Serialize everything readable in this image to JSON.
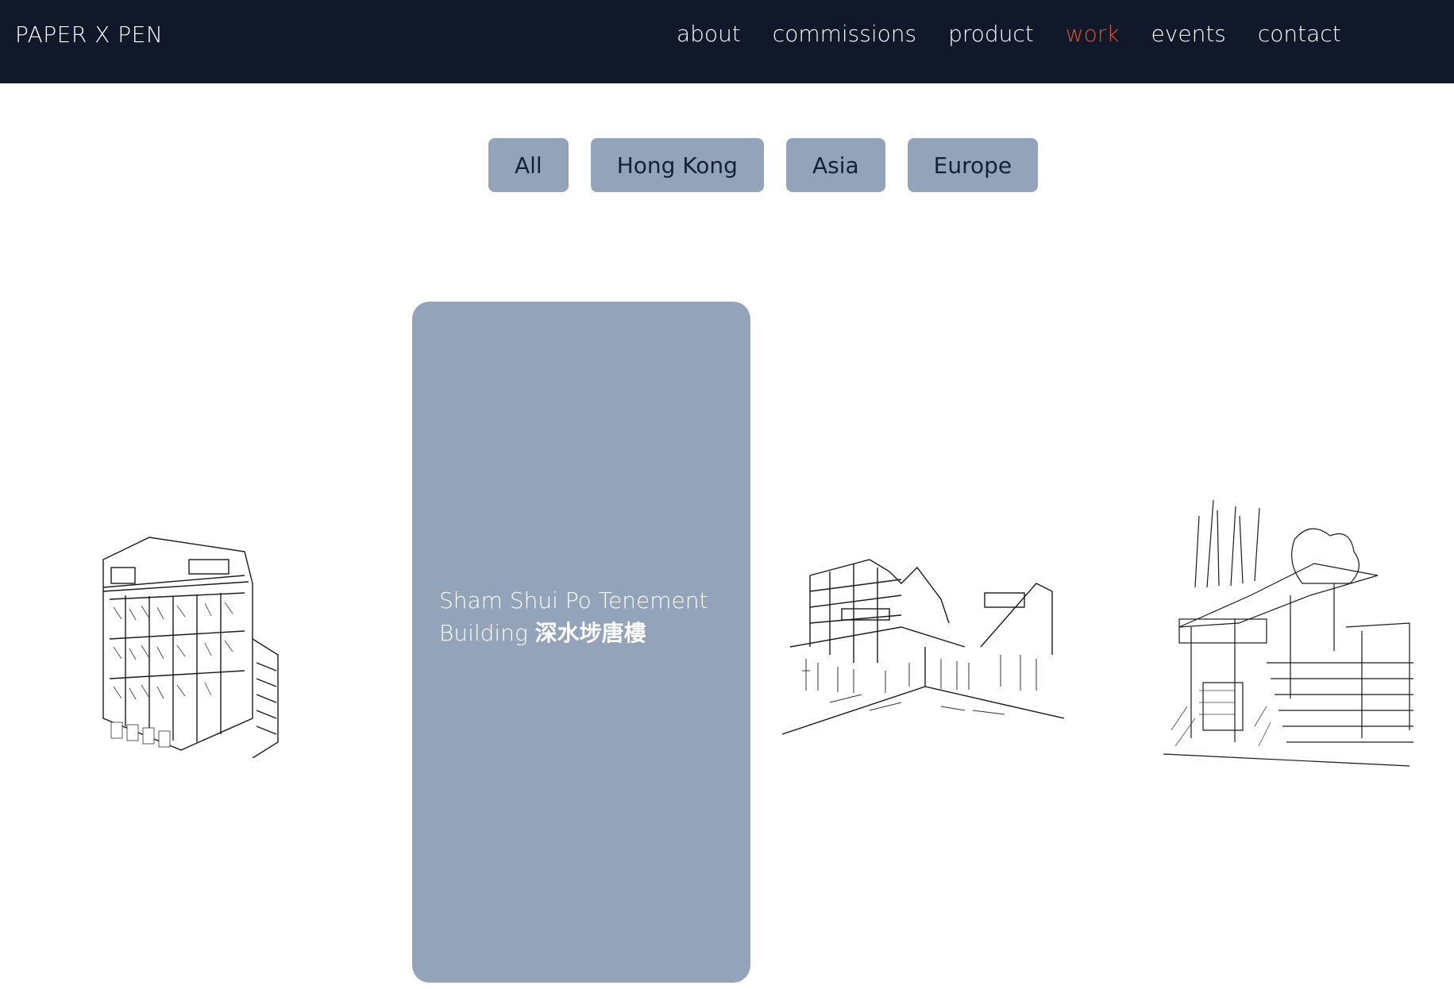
{
  "header": {
    "brand": "PAPER X PEN",
    "nav": [
      {
        "label": "about"
      },
      {
        "label": "commissions"
      },
      {
        "label": "product"
      },
      {
        "label": "work",
        "active": true
      },
      {
        "label": "events"
      },
      {
        "label": "contact"
      }
    ]
  },
  "filters": [
    "All",
    "Hong Kong",
    "Asia",
    "Europe"
  ],
  "gallery": {
    "featured_title": "Sham Shui Po Tenement Building",
    "featured_title_cjk": "深水埗唐樓"
  },
  "colors": {
    "header_bg": "#11182a",
    "accent_active": "#e4512b",
    "filter_bg": "#93a4ba",
    "card_bg": "#93a4ba"
  }
}
